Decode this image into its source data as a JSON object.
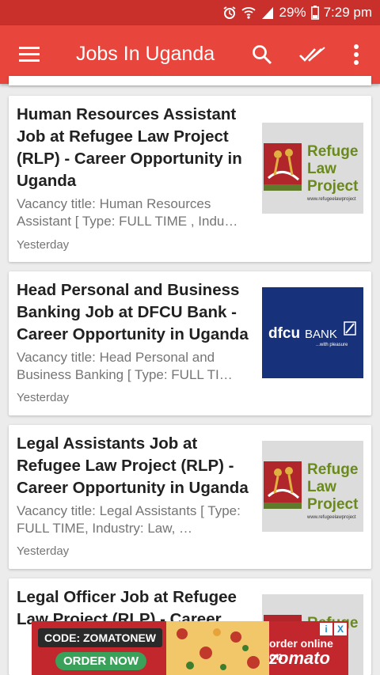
{
  "status": {
    "battery": "29%",
    "time": "7:29 pm"
  },
  "appbar": {
    "title": "Jobs In Uganda"
  },
  "icons": {
    "menu": "hamburger-icon",
    "search": "search-icon",
    "mark_all_read": "double-check-icon",
    "overflow": "more-vert-icon"
  },
  "articles": [
    {
      "title": "Human Resources Assistant Job at Refugee Law Project (RLP) - Career Opportunity in Uganda",
      "snippet": "Vacancy title: Human Resources Assistant [ Type: FULL TIME , Indu…",
      "date": "Yesterday",
      "thumb": {
        "line1": "Refuge",
        "line2": "Law",
        "line3": "Project",
        "url": "www.refugeelawproject"
      }
    },
    {
      "title": "Head Personal and Business Banking Job at DFCU Bank - Career Opportunity in Uganda",
      "snippet": "Vacancy title: Head Personal and Business Banking [ Type: FULL TI…",
      "date": "Yesterday",
      "thumb": {
        "brand": "dfcu",
        "brand2": "BANK",
        "tagline": "...with pleasure"
      }
    },
    {
      "title": "Legal Assistants Job at Refugee Law Project (RLP) - Career Opportunity in Uganda",
      "snippet": "Vacancy title: Legal Assistants [ Type: FULL TIME, Industry: Law, …",
      "date": "Yesterday",
      "thumb": {
        "line1": "Refuge",
        "line2": "Law",
        "line3": "Project",
        "url": "www.refugeelawproject"
      }
    },
    {
      "title": "Legal Officer Job at Refugee Law Project (RLP) - Career",
      "thumb": {
        "line1": "Refuge"
      }
    }
  ],
  "ad": {
    "code": "CODE: ZOMATONEW",
    "cta": "ORDER NOW",
    "tagline": "order online on",
    "brand": "zomato",
    "info": "i",
    "close": "X"
  },
  "colors": {
    "appbar": "#e8453c",
    "statusbar": "#c9302c",
    "card_bg": "#ffffff",
    "page_bg": "#ececec"
  }
}
